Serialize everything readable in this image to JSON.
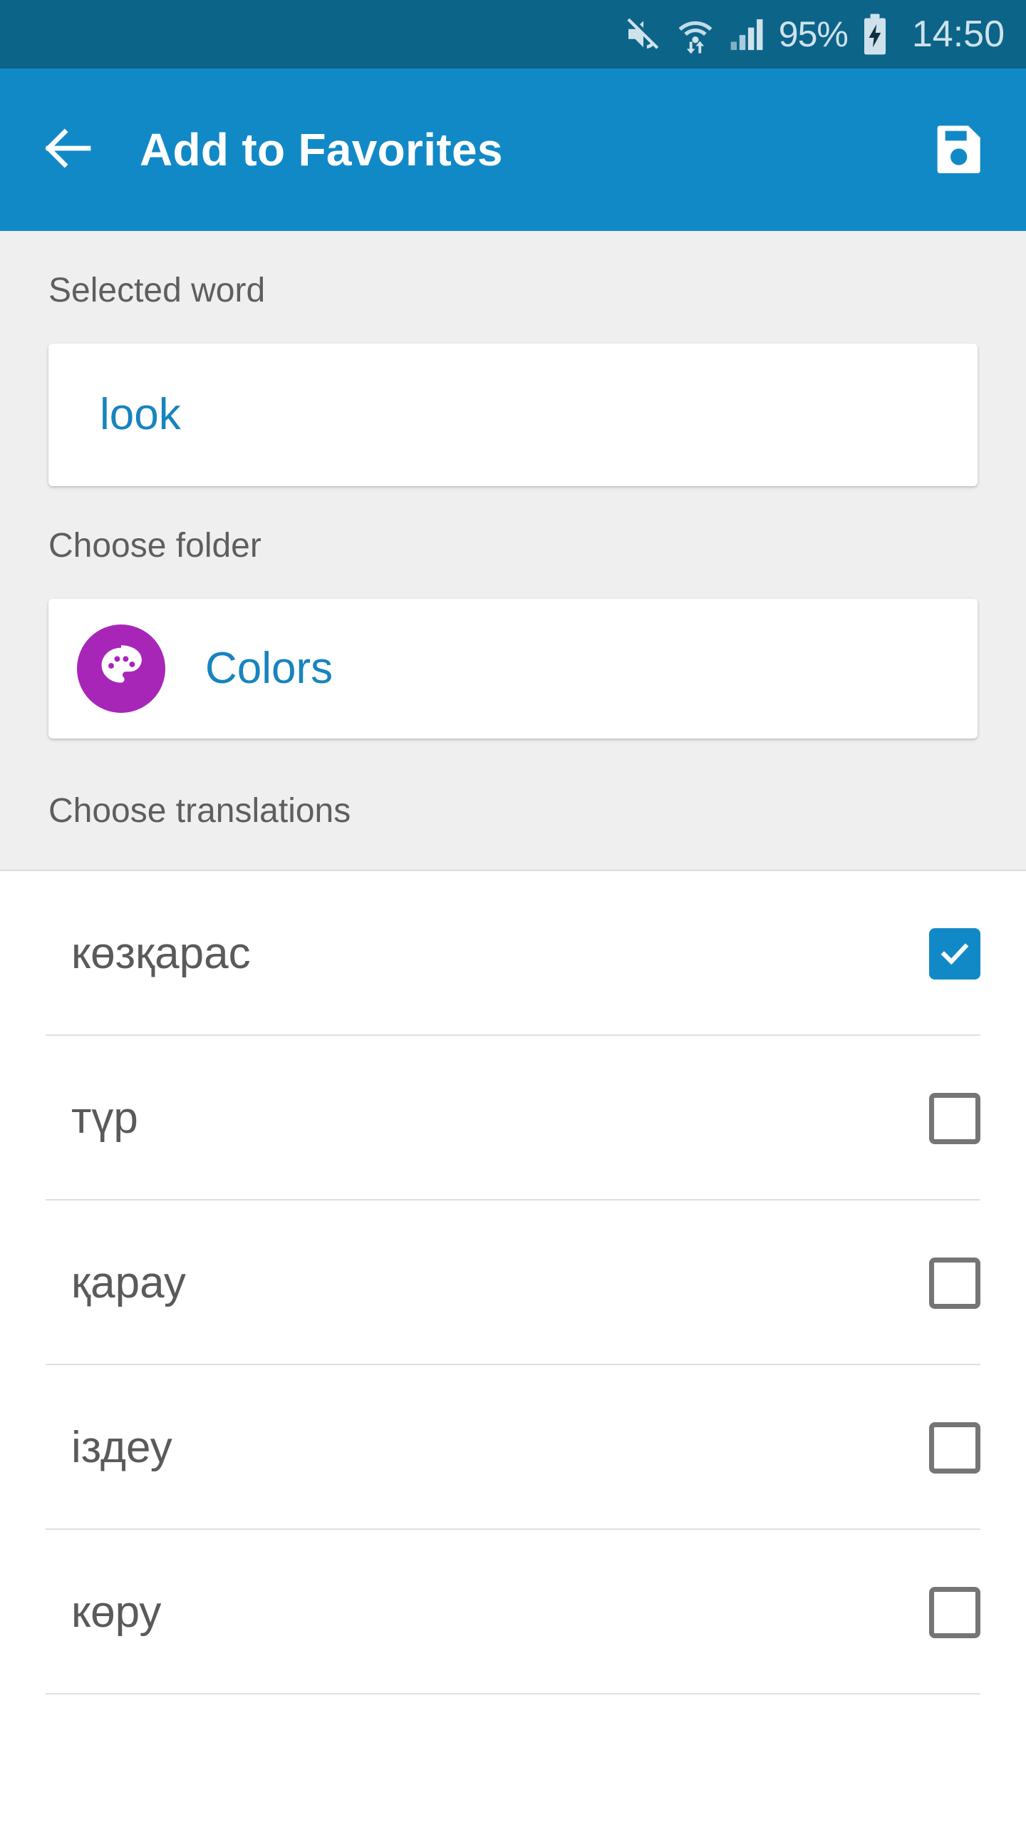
{
  "status_bar": {
    "icons": [
      "mute-icon",
      "wifi-icon",
      "signal-icon"
    ],
    "battery_percent": "95%",
    "battery_icon": "battery-charging-icon",
    "clock": "14:50",
    "background_color": "#0c6489",
    "text_color": "#cfe2ec"
  },
  "app_bar": {
    "back_icon": "arrow-left-icon",
    "title": "Add to Favorites",
    "save_icon": "save-icon",
    "background_color": "#1189c6",
    "text_color": "#ffffff"
  },
  "form": {
    "selected_word": {
      "label": "Selected word",
      "value": "look",
      "value_color": "#1784be"
    },
    "folder": {
      "label": "Choose folder",
      "value": "Colors",
      "icon": "palette-icon",
      "avatar_color": "#a726b8",
      "value_color": "#1784be"
    },
    "translations_label": "Choose translations",
    "label_color": "#5e5e5e",
    "background_color": "#efeff0"
  },
  "translations": {
    "items": [
      {
        "text": "көзқарас",
        "checked": true
      },
      {
        "text": "түр",
        "checked": false
      },
      {
        "text": "қарау",
        "checked": false
      },
      {
        "text": "іздеу",
        "checked": false
      },
      {
        "text": "көру",
        "checked": false
      }
    ],
    "checked_color": "#1189c6",
    "unchecked_color": "#757575",
    "text_color": "#5a5a5a"
  }
}
